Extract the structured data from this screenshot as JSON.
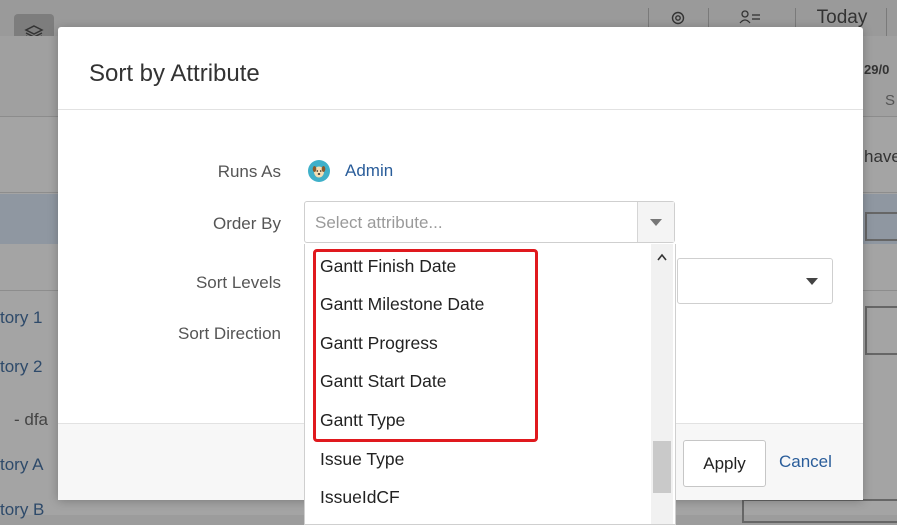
{
  "background": {
    "toolbar": {
      "today_label": "Today"
    },
    "date_header": {
      "date": "29/0",
      "day": "S"
    },
    "cell_text": "have",
    "rows": [
      "tory 1",
      "tory 2",
      "- dfa",
      "tory A",
      "tory B"
    ]
  },
  "modal": {
    "title": "Sort by Attribute",
    "fields": {
      "runs_as": {
        "label": "Runs As",
        "value": "Admin"
      },
      "order_by": {
        "label": "Order By",
        "placeholder": "Select attribute..."
      },
      "sort_levels": {
        "label": "Sort Levels"
      },
      "sort_direction": {
        "label": "Sort Direction"
      }
    },
    "dropdown_options": [
      "Gantt Finish Date",
      "Gantt Milestone Date",
      "Gantt Progress",
      "Gantt Start Date",
      "Gantt Type",
      "Issue Type",
      "IssueIdCF"
    ],
    "footer": {
      "apply_label": "Apply",
      "cancel_label": "Cancel"
    }
  },
  "colors": {
    "highlight": "#e0191e",
    "link": "#2a5d9a",
    "avatar": "#3fb0c9"
  }
}
